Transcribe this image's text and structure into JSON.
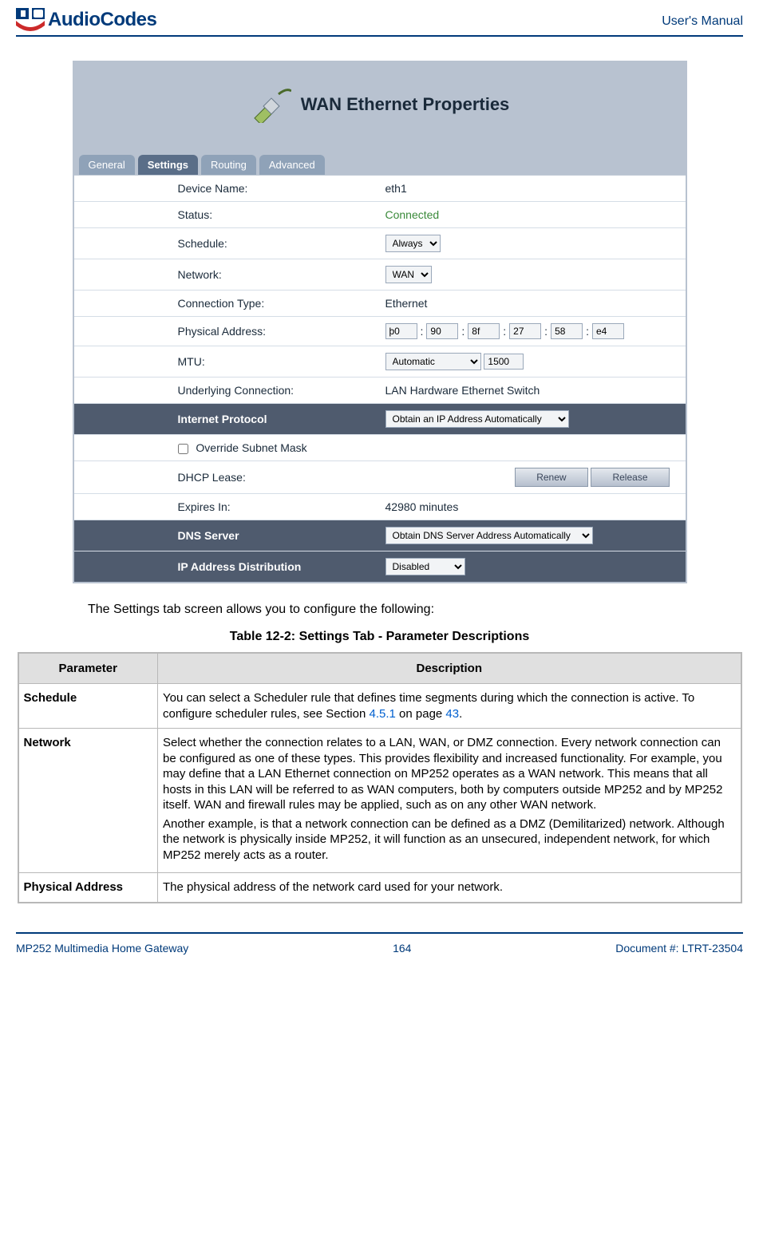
{
  "header": {
    "logo_text": "AudioCodes",
    "right_label": "User's Manual"
  },
  "screenshot": {
    "title": "WAN Ethernet Properties",
    "tabs": {
      "general": "General",
      "settings": "Settings",
      "routing": "Routing",
      "advanced": "Advanced"
    },
    "rows": {
      "device_name_label": "Device Name:",
      "device_name_value": "eth1",
      "status_label": "Status:",
      "status_value": "Connected",
      "schedule_label": "Schedule:",
      "schedule_value": "Always",
      "network_label": "Network:",
      "network_value": "WAN",
      "conn_type_label": "Connection Type:",
      "conn_type_value": "Ethernet",
      "phys_addr_label": "Physical Address:",
      "mac": {
        "a": "þ0",
        "b": "90",
        "c": "8f",
        "d": "27",
        "e": "58",
        "f": "e4"
      },
      "mtu_label": "MTU:",
      "mtu_mode": "Automatic",
      "mtu_value": "1500",
      "underlying_label": "Underlying Connection:",
      "underlying_value": "LAN Hardware Ethernet Switch",
      "ip_section": "Internet Protocol",
      "ip_mode": "Obtain an IP Address Automatically",
      "override_label": "Override Subnet Mask",
      "dhcp_lease_label": "DHCP Lease:",
      "renew_btn": "Renew",
      "release_btn": "Release",
      "expires_label": "Expires In:",
      "expires_value": "42980 minutes",
      "dns_section": "DNS Server",
      "dns_mode": "Obtain DNS Server Address Automatically",
      "ipdist_section": "IP Address Distribution",
      "ipdist_value": "Disabled"
    }
  },
  "body_text": "The Settings tab screen allows you to configure the following:",
  "table_caption": "Table 12-2: Settings Tab - Parameter Descriptions",
  "paramtable": {
    "head_parameter": "Parameter",
    "head_description": "Description",
    "rows": [
      {
        "param": "Schedule",
        "desc_pre": "You can select a Scheduler rule that defines time segments during which the connection is active. To configure scheduler rules, see Section ",
        "link1": "4.5.1",
        "desc_mid": " on page ",
        "link2": "43",
        "desc_post": "."
      },
      {
        "param": "Network",
        "desc1": "Select whether the connection relates to a LAN, WAN, or DMZ connection. Every network connection can be configured as one of these types. This provides flexibility and increased functionality. For example, you may define that a LAN Ethernet connection on MP252 operates as a WAN network. This means that all hosts in this LAN will be referred to as WAN computers, both by computers outside MP252 and by MP252 itself. WAN and firewall rules may be applied, such as on any other WAN network.",
        "desc2": "Another example, is that a network connection can be defined as a DMZ (Demilitarized) network. Although the network is physically inside MP252, it will function as an unsecured, independent network, for which MP252 merely acts as a router."
      },
      {
        "param": "Physical Address",
        "desc": "The physical address of the network card used for your network."
      }
    ]
  },
  "footer": {
    "left": "MP252 Multimedia Home Gateway",
    "center": "164",
    "right": "Document #: LTRT-23504"
  }
}
